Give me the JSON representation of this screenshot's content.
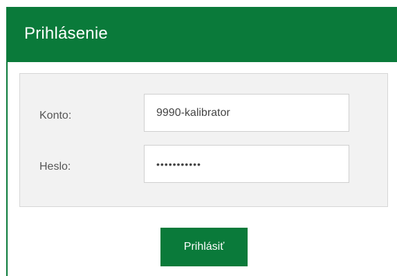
{
  "header": {
    "title": "Prihlásenie"
  },
  "form": {
    "account_label": "Konto:",
    "account_value": "9990-kalibrator",
    "password_label": "Heslo:",
    "password_value": "•••••••••••",
    "submit_label": "Prihlásiť"
  },
  "colors": {
    "brand_green": "#0a7a3a",
    "form_background": "#f2f2f2",
    "input_border": "#cfcfcf",
    "label_text": "#555555"
  }
}
